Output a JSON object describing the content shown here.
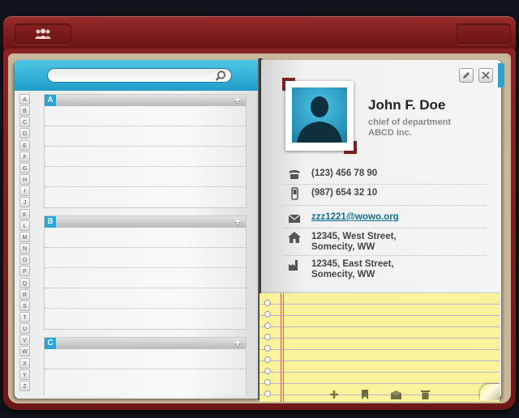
{
  "search": {
    "placeholder": ""
  },
  "alphabet": [
    "A",
    "B",
    "C",
    "D",
    "E",
    "F",
    "G",
    "H",
    "I",
    "J",
    "K",
    "L",
    "M",
    "N",
    "O",
    "P",
    "Q",
    "R",
    "S",
    "T",
    "U",
    "V",
    "W",
    "X",
    "Y",
    "Z"
  ],
  "sections": [
    {
      "letter": "A",
      "add": "+"
    },
    {
      "letter": "B",
      "add": "+"
    },
    {
      "letter": "C",
      "add": "+"
    }
  ],
  "contact": {
    "name": "John F. Doe",
    "title": "chief of department",
    "company": "ABCD inc.",
    "phone": "(123) 456 78 90",
    "mobile": "(987) 654 32 10",
    "email": "zzz1221@wowo.org",
    "home_address_line1": "12345, West Street,",
    "home_address_line2": "Somecity, WW",
    "work_address_line1": "12345, East Street,",
    "work_address_line2": "Somecity, WW"
  },
  "notepad_tools": [
    "add-icon",
    "bookmark-icon",
    "mail-icon",
    "trash-icon"
  ],
  "colors": {
    "accent": "#29a6d3",
    "leather": "#7a1b1b",
    "note": "#fbf39b"
  }
}
